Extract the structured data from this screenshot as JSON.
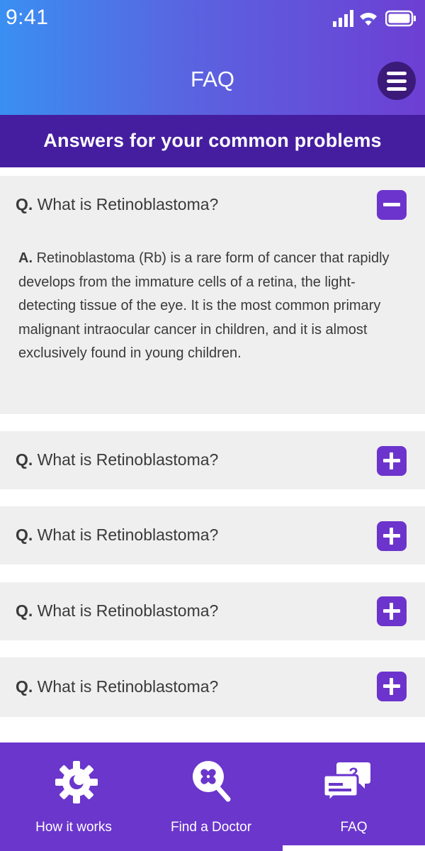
{
  "status_bar": {
    "time": "9:41"
  },
  "header": {
    "title": "FAQ",
    "subtitle": "Answers for your common problems"
  },
  "faq": {
    "items": [
      {
        "prefix": "Q.",
        "question": "What is Retinoblastoma?",
        "expanded": true,
        "answer_prefix": "A.",
        "answer": "Retinoblastoma (Rb) is a rare form of cancer that rapidly develops from the immature cells of a retina, the light-detecting tissue of the eye. It is the most common primary malignant intraocular cancer in children, and it is almost exclusively found in young children."
      },
      {
        "prefix": "Q.",
        "question": "What is Retinoblastoma?",
        "expanded": false
      },
      {
        "prefix": "Q.",
        "question": "What is Retinoblastoma?",
        "expanded": false
      },
      {
        "prefix": "Q.",
        "question": "What is Retinoblastoma?",
        "expanded": false
      },
      {
        "prefix": "Q.",
        "question": "What is Retinoblastoma?",
        "expanded": false
      }
    ]
  },
  "bottom_nav": {
    "items": [
      {
        "label": "How it works",
        "icon": "gear-icon",
        "active": false
      },
      {
        "label": "Find a Doctor",
        "icon": "search-doctor-icon",
        "active": false
      },
      {
        "label": "FAQ",
        "icon": "faq-chat-icon",
        "active": true
      }
    ]
  },
  "colors": {
    "header_gradient_start": "#3a8ff2",
    "header_gradient_end": "#6d3fd3",
    "subheader_bg": "#451ea0",
    "accent": "#6c34cc",
    "card_bg": "#efefef",
    "nav_bg": "#6a36cc"
  }
}
